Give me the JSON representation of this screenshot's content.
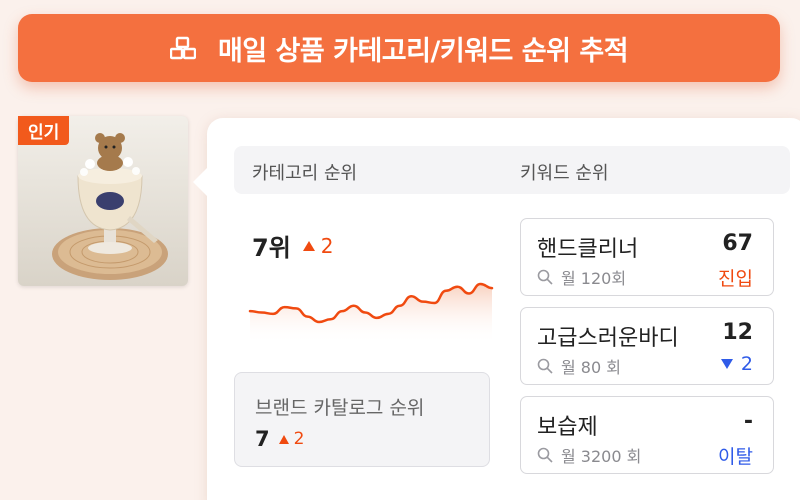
{
  "banner": {
    "title": "매일 상품 카테고리/키워드 순위 추적",
    "icon": "boxes-icon"
  },
  "product": {
    "badge": "인기",
    "image_description_icon": "product-photo"
  },
  "columns": {
    "category_header": "카테고리 순위",
    "keyword_header": "키워드 순위"
  },
  "category_rank": {
    "rank": "7위",
    "change": "2",
    "change_direction": "up",
    "trend_values": [
      30,
      29,
      28,
      33,
      32,
      26,
      22,
      24,
      30,
      34,
      29,
      25,
      28,
      34,
      41,
      37,
      36,
      45,
      48,
      43,
      50,
      47
    ],
    "trend_color": "#f04a10"
  },
  "brand_catalog": {
    "label": "브랜드 카탈로그 순위",
    "rank": "7",
    "change": "2",
    "change_direction": "up"
  },
  "keywords": [
    {
      "name": "핸드클리너",
      "rank": "67",
      "volume": "월 120회",
      "status": "진입",
      "status_type": "new"
    },
    {
      "name": "고급스러운바디",
      "rank": "12",
      "volume": "월 80 회",
      "status": "2",
      "status_type": "down"
    },
    {
      "name": "보습제",
      "rank": "-",
      "volume": "월 3200 회",
      "status": "이탈",
      "status_type": "out"
    }
  ],
  "colors": {
    "accent": "#f4703f",
    "up": "#f04a10",
    "down": "#2f5be8",
    "background": "#fbf1ec"
  }
}
